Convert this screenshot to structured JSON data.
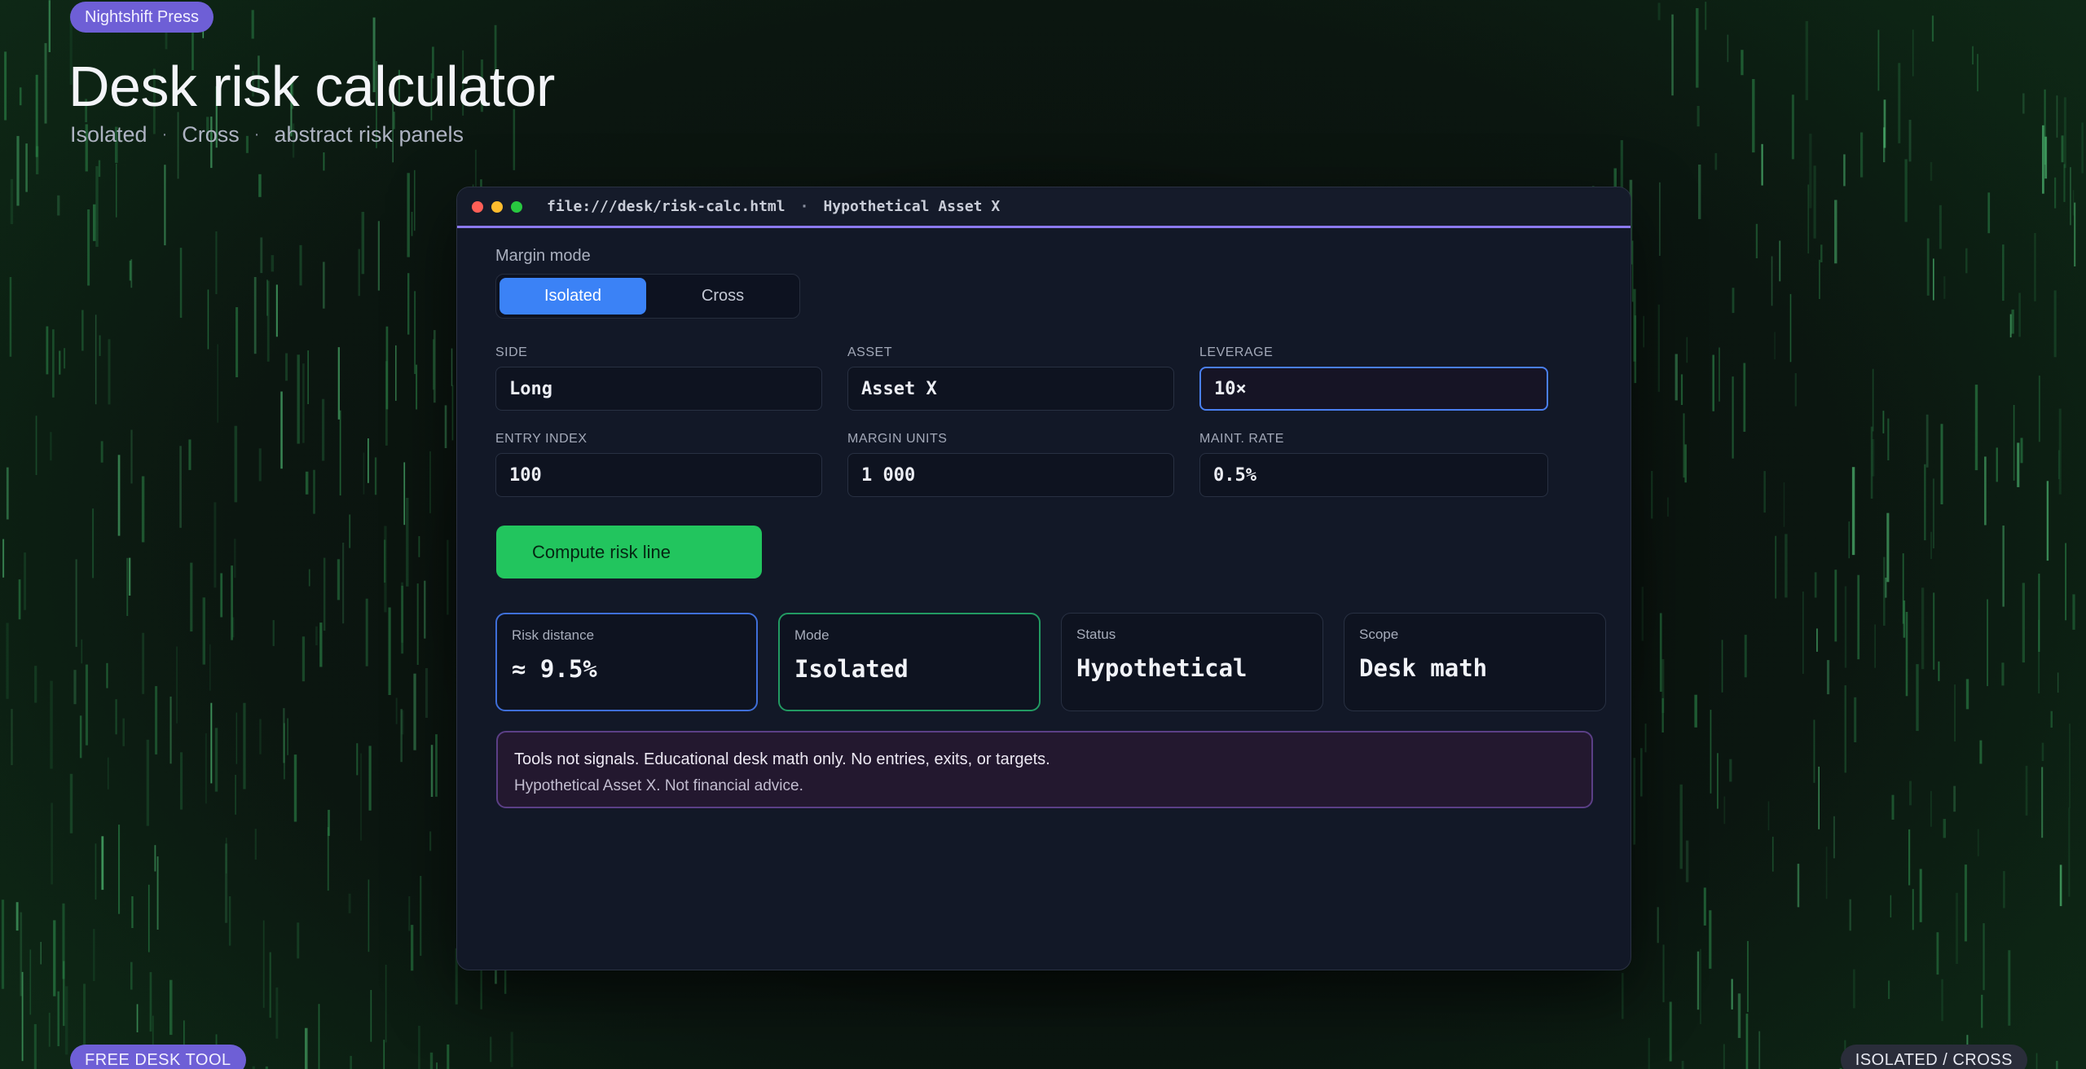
{
  "brand": {
    "badge": "Nightshift Press"
  },
  "hero": {
    "title": "Desk risk calculator",
    "subtitle": [
      "Isolated",
      "Cross",
      "abstract risk panels"
    ],
    "separator": "·"
  },
  "window": {
    "path": "file:///desk/risk-calc.html",
    "separator": "·",
    "asset_title": "Hypothetical Asset X"
  },
  "margin_mode": {
    "label": "Margin mode",
    "options": [
      "Isolated",
      "Cross"
    ],
    "selected": "Isolated"
  },
  "fields": {
    "side": {
      "label": "SIDE",
      "value": "Long"
    },
    "asset": {
      "label": "ASSET",
      "value": "Asset X"
    },
    "leverage": {
      "label": "LEVERAGE",
      "value": "10×"
    },
    "entry_index": {
      "label": "ENTRY INDEX",
      "value": "100"
    },
    "margin_units": {
      "label": "MARGIN UNITS",
      "value": "1 000"
    },
    "maint_rate": {
      "label": "MAINT. RATE",
      "value": "0.5%"
    }
  },
  "compute_button": {
    "label": "Compute risk line"
  },
  "results": [
    {
      "label": "Risk distance",
      "value": "≈ 9.5%"
    },
    {
      "label": "Mode",
      "value": "Isolated"
    },
    {
      "label": "Status",
      "value": "Hypothetical"
    },
    {
      "label": "Scope",
      "value": "Desk math"
    }
  ],
  "notice": {
    "line1": "Tools not signals. Educational desk math only. No entries, exits, or targets.",
    "line2": "Hypothetical Asset X. Not financial advice."
  },
  "footer": {
    "left_badge": "FREE DESK TOOL",
    "right_badge": "ISOLATED / CROSS"
  },
  "colors": {
    "accent_blue": "#3b82f6",
    "accent_green": "#22c55e",
    "accent_purple": "#8b79ee",
    "window_bg": "#121827"
  }
}
